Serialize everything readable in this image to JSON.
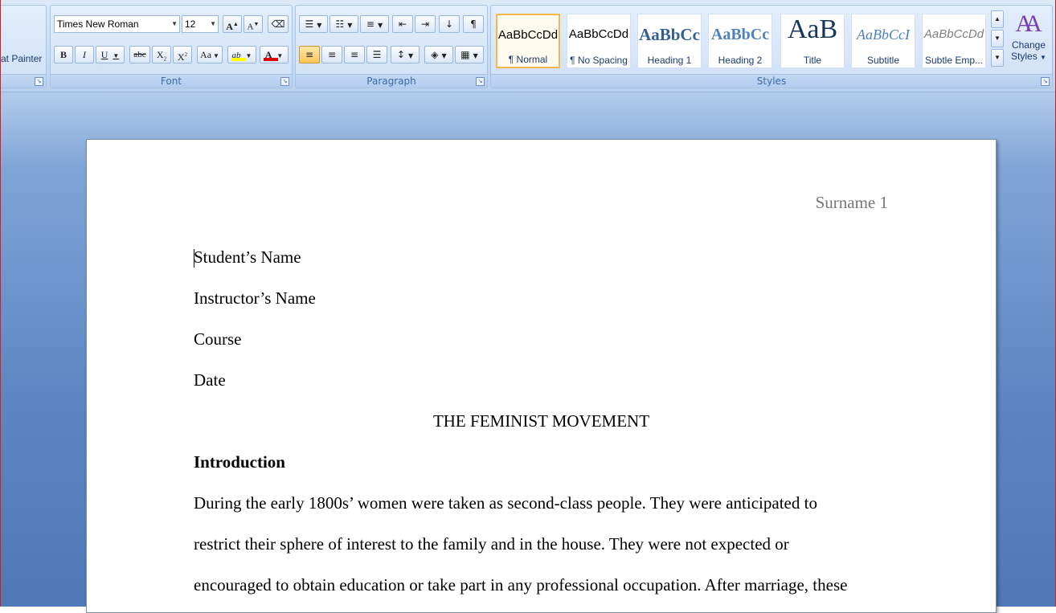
{
  "clipboard": {
    "format_painter_label": "at Painter"
  },
  "font": {
    "group_label": "Font",
    "name": "Times New Roman",
    "size": "12",
    "grow_label": "A",
    "shrink_label": "A",
    "bold_label": "B",
    "italic_label": "I",
    "underline_label": "U",
    "strike_label": "abc",
    "subscript_label": "X",
    "superscript_label": "X",
    "case_label": "Aa",
    "highlight_label": "ab",
    "font_color_label": "A",
    "highlight_color": "#ffff00",
    "font_color": "#e00000"
  },
  "paragraph": {
    "group_label": "Paragraph"
  },
  "styles": {
    "group_label": "Styles",
    "tiles": [
      {
        "sample": "AaBbCcDd",
        "name": "¶ Normal"
      },
      {
        "sample": "AaBbCcDd",
        "name": "¶ No Spacing"
      },
      {
        "sample": "AaBbCc",
        "name": "Heading 1"
      },
      {
        "sample": "AaBbCc",
        "name": "Heading 2"
      },
      {
        "sample": "AaB",
        "name": "Title"
      },
      {
        "sample": "AaBbCcI",
        "name": "Subtitle"
      },
      {
        "sample": "AaBbCcDd",
        "name": "Subtle Emp..."
      }
    ],
    "change_styles_line1": "Change",
    "change_styles_line2": "Styles"
  },
  "document": {
    "header": "Surname 1",
    "lines": [
      "Student’s Name",
      "Instructor’s Name",
      "Course",
      "Date"
    ],
    "title": "THE FEMINIST MOVEMENT",
    "section_heading": "Introduction",
    "body": [
      "During the early 1800s’ women were taken as second-class people. They were anticipated to",
      "restrict their sphere of interest to the family and in the house. They were not expected or",
      "encouraged to obtain education or take part in any professional occupation. After marriage, these"
    ]
  }
}
